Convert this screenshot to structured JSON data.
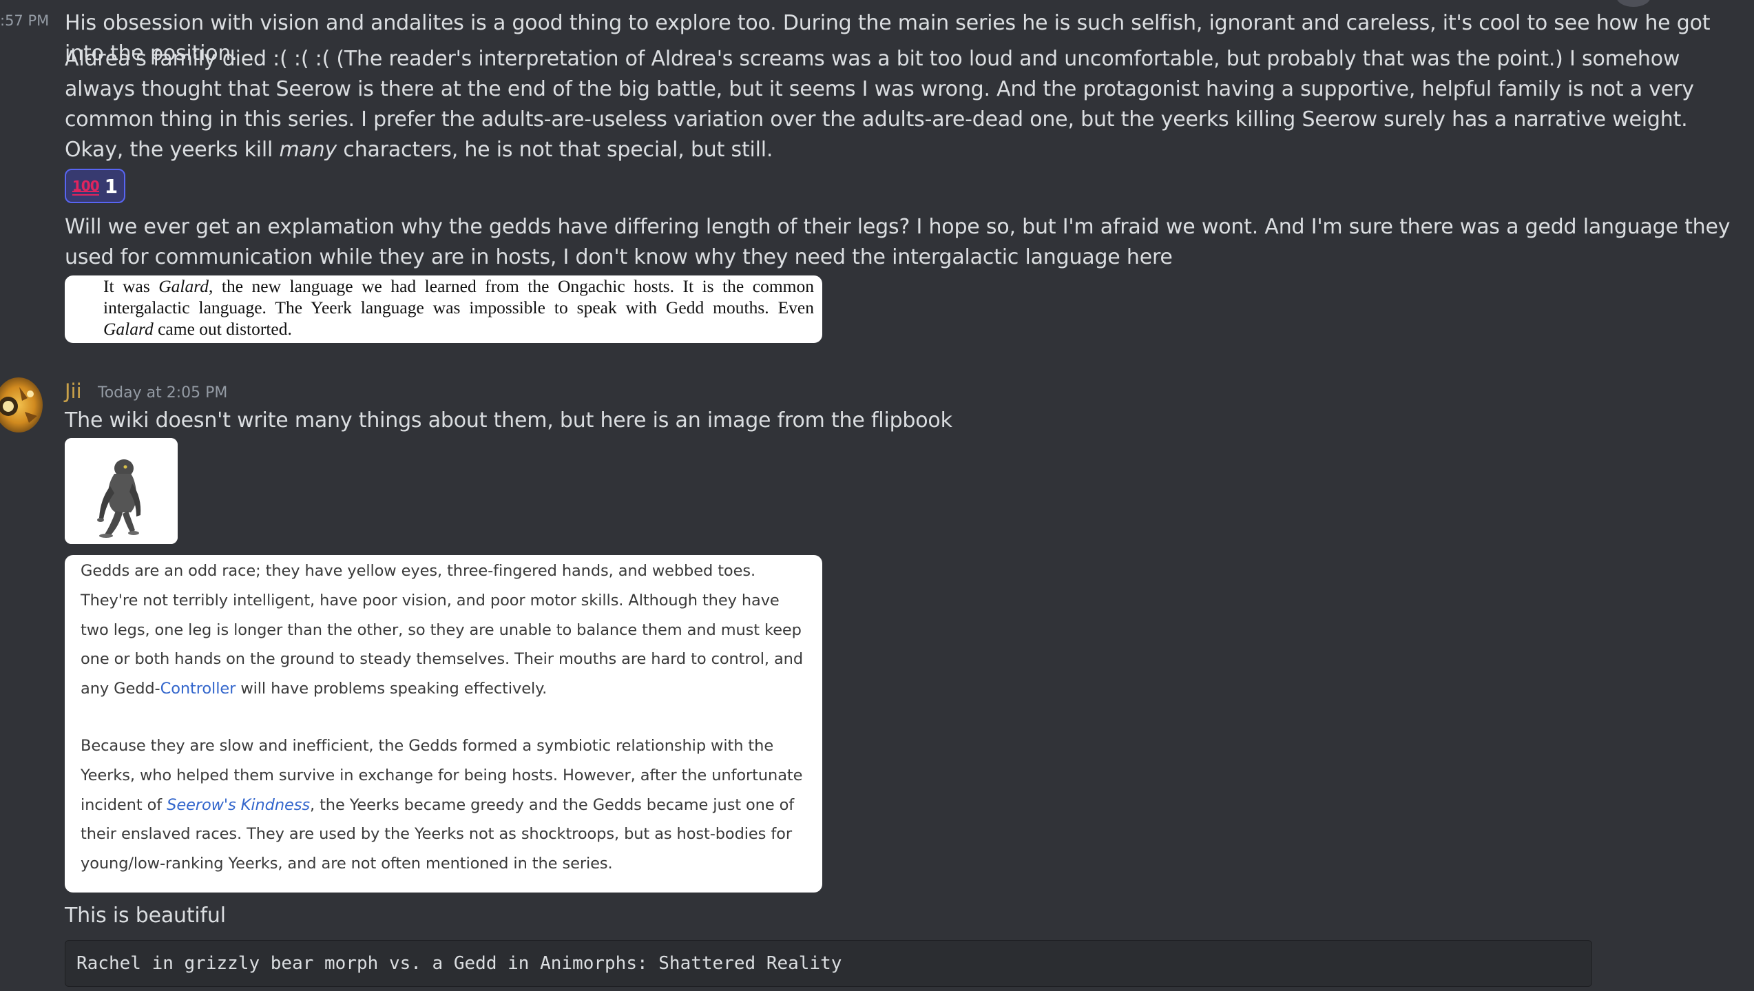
{
  "messages": {
    "prev_timestamp": ":57 PM",
    "para1": "His obsession with vision and andalites is a good thing to explore too. During the main series he is such selfish, ignorant and careless, it's cool to see how he got into the position.",
    "para2_a": "Aldrea's family died :( :( :(  (The reader's interpretation of Aldrea's screams was a bit too loud and uncomfortable, but probably that was the point.) I somehow always thought that Seerow is there at the end of the big battle, but it seems I was wrong. And the protagonist having a supportive, helpful family is not a very common thing in this series. I prefer the adults-are-useless variation over the adults-are-dead one, but the yeerks killing Seerow surely has a narrative weight. Okay, the yeerks kill ",
    "para2_em": "many",
    "para2_b": " characters, he is not that special, but still.",
    "reaction": {
      "emoji": "100",
      "emoji_name": "hundred-points-emoji",
      "count": "1",
      "accent_color": "#5865f2"
    },
    "para3": "Will we ever get an explamation why the gedds have differing length of their legs? I hope so, but I'm afraid we wont. And I'm sure there was a gedd language they used for communication while they are in hosts, I don't know why they need the intergalactic language here",
    "excerpt": {
      "t1": "It was ",
      "t1_em": "Galard",
      "t2": ", the new language we had learned from the Ongachic hosts. It is the common intergalactic language. The Yeerk language was impossible to speak with Gedd mouths. Even ",
      "t2_em": "Galard",
      "t3": " came out distorted."
    },
    "jii": {
      "username": "Jii",
      "username_color": "#c9a14a",
      "timestamp": "Today at 2:05 PM",
      "text1": "The wiki doesn't write many things about them, but here is an image from the flipbook",
      "wiki": {
        "p1_a": "Gedds are an odd race; they have yellow eyes, three-fingered hands, and webbed toes. They're not terribly intelligent, have poor vision, and poor motor skills. Although they have two legs, one leg is longer than the other, so they are unable to balance them and must keep one or both hands on the ground to steady themselves. Their mouths are hard to control, and any Gedd-",
        "p1_link": "Controller",
        "p1_b": " will have problems speaking effectively.",
        "p2_a": "Because they are slow and inefficient, the Gedds formed a symbiotic relationship with the Yeerks, who helped them survive in exchange for being hosts. However, after the unfortunate incident of ",
        "p2_link": "Seerow's Kindness",
        "p2_b": ", the Yeerks became greedy and the Gedds became just one of their enslaved races. They are used by the Yeerks not as shocktroops, but as host-bodies for young/low-ranking Yeerks, and are not often mentioned in the series."
      },
      "text2": "This is beautiful",
      "code": "Rachel in grizzly bear morph vs. a Gedd in Animorphs: Shattered Reality"
    }
  }
}
